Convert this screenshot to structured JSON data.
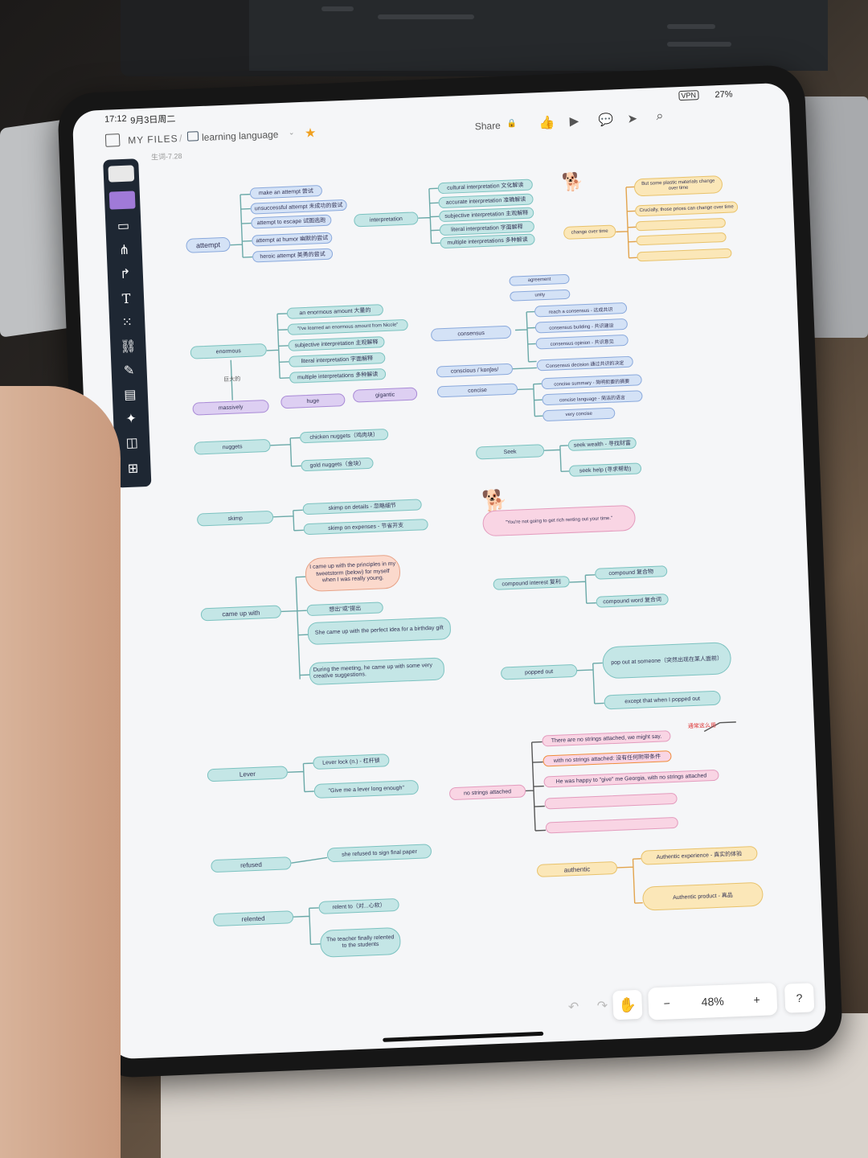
{
  "status": {
    "time": "17:12",
    "date": "9月3日周二",
    "battery": "27%",
    "vpn": "VPN"
  },
  "topbar": {
    "my_files": "MY FILES",
    "separator": "/",
    "board_title": "learning language",
    "share": "Share",
    "caption": "生词-7.28"
  },
  "zoom": {
    "minus": "−",
    "value": "48%",
    "plus": "+",
    "help": "?"
  },
  "nodes": {
    "attempt": "attempt",
    "a1": "make an attempt 尝试",
    "a2": "unsuccessful attempt 未成功的尝试",
    "a3": "attempt to escape 试图逃跑",
    "a4": "attempt at humor 幽默的尝试",
    "a5": "heroic attempt 英勇的尝试",
    "interpretation": "interpretation",
    "i1": "cultural interpretation 文化解读",
    "i2": "accurate interpretation 准确解读",
    "i3": "subjective interpretation 主观解释",
    "i4": "literal interpretation 字面解释",
    "i5": "multiple interpretations 多种解读",
    "change": "change over time",
    "c1": "But some plastic materials change over time",
    "c2": "Crucially, those prices can change over time",
    "enormous": "enormous",
    "e1": "an enormous amount 大量的",
    "e2": "\"I've learned an enormous amount from Nicole\"",
    "e3": "subjective interpretation 主观解释",
    "e4": "literal interpretation 字面解释",
    "e5": "multiple interpretations 多种解读",
    "big": "巨大的",
    "massively": "massively",
    "huge": "huge",
    "gigantic": "gigantic",
    "agreement": "agreement",
    "unity": "unity",
    "consensus": "consensus",
    "cs1": "reach a consensus - 达成共识",
    "cs2": "consensus building - 共识建设",
    "cs3": "consensus opinion - 共识意见",
    "conscious": "conscious /ˈkɒnʃəs/",
    "cs4": "Consensus decision 通过共识的决定",
    "concise": "concise",
    "cc1": "concise summary - 简明扼要的摘要",
    "cc2": "concise language - 简洁的语言",
    "cc3": "very concise",
    "nuggets": "nuggets",
    "n1": "chicken nuggets（鸡肉块）",
    "n2": "gold nuggets（金块）",
    "seek": "Seek",
    "sk1": "seek wealth - 寻找财富",
    "sk2": "seek help (寻求帮助)",
    "skimp": "skimp",
    "sp1": "skimp on details - 忽略细节",
    "sp2": "skimp on expenses - 节省开支",
    "quote": "\"You're not going to get rich renting out your time.\"",
    "cameup": "came up with",
    "cu1": "I came up with the principles in my tweetstorm (below) for myself when I was really young.",
    "cu2": "想出\"或\"提出",
    "cu3": "She came up with the perfect idea for a birthday gift",
    "cu4": "During the meeting, he came up with some very creative suggestions.",
    "compound": "compound interest 复利",
    "cp1": "compound 复合物",
    "cp2": "compound word 复合词",
    "popped": "popped out",
    "pp1": "pop out at someone（突然出现在某人面前）",
    "pp2": "except that when I popped out",
    "lever": "Lever",
    "lv1": "Lever lock (n.) - 杠杆锁",
    "lv2": "\"Give me a lever long enough\"",
    "nostrings": "no strings attached",
    "ns1": "There are no strings attached, we might say.",
    "ns2": "with no strings attached: 没有任何附带条件",
    "ns3": "He was happy to \"give\" me Georgia, with no strings attached",
    "ns_note": "通常这么用",
    "refused": "refused",
    "rf1": "she refused to sign final paper",
    "authentic": "authentic",
    "au1": "Authentic experience - 真实的体验",
    "au2": "Authentic product - 真品",
    "relented": "relented",
    "rl1": "relent to（对...心软）",
    "rl2": "The teacher finally relented to the students"
  },
  "icons": [
    "sidebar-toggle-icon",
    "board-icon",
    "chevron-down-icon",
    "star-icon",
    "lock-icon",
    "like-icon",
    "present-icon",
    "comment-icon",
    "send-icon",
    "search-icon",
    "arrow-icon",
    "text-icon",
    "grid-icon",
    "link-icon",
    "pen-icon",
    "frame-icon",
    "ai-sparkle-icon",
    "layout-icon",
    "plus-icon",
    "hand-icon",
    "undo-icon",
    "redo-icon"
  ],
  "colors": {
    "teal": "#c4e6e6",
    "blue": "#d4e2f6",
    "purple": "#ddcff2",
    "yellow": "#fbe7b8",
    "pink": "#f9d5e4",
    "toolbar": "#1e2733",
    "star": "#f0a020"
  }
}
